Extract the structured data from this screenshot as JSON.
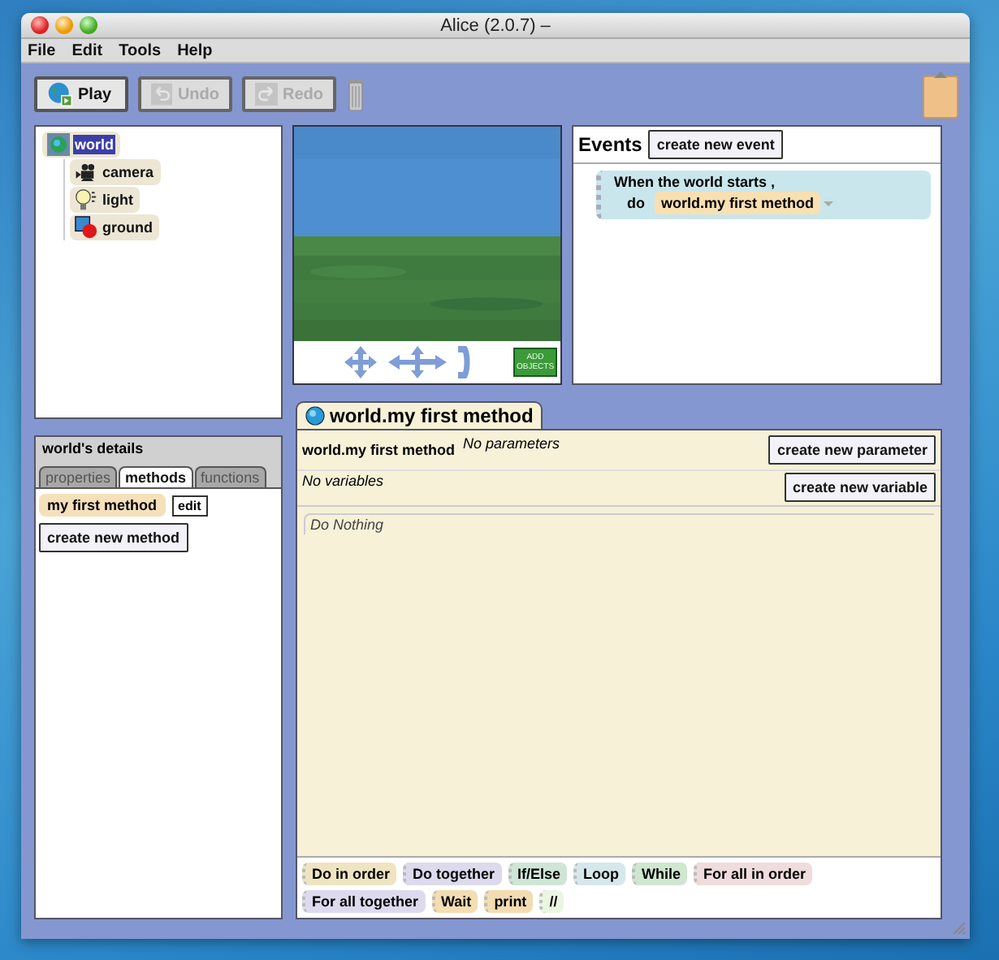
{
  "window": {
    "title": "Alice (2.0.7) –"
  },
  "menu": [
    "File",
    "Edit",
    "Tools",
    "Help"
  ],
  "toolbar": [
    {
      "label": "Play",
      "kind": "play",
      "disabled": false
    },
    {
      "label": "Undo",
      "kind": "undo",
      "disabled": true
    },
    {
      "label": "Redo",
      "kind": "redo",
      "disabled": true
    }
  ],
  "object_tree": [
    {
      "label": "world",
      "kind": "world",
      "selected": true,
      "children": [
        {
          "label": "camera",
          "kind": "camera",
          "selected": false
        },
        {
          "label": "light",
          "kind": "light",
          "selected": false
        },
        {
          "label": "ground",
          "kind": "ground",
          "selected": false
        }
      ]
    }
  ],
  "scene_view": {
    "add_objects_button": "ADD OBJECTS"
  },
  "events": {
    "title": "Events",
    "create_button": "create new event",
    "items": [
      {
        "trigger": "When the world starts ,",
        "do_label": "do",
        "method": "world.my first method"
      }
    ]
  },
  "details": {
    "title": "world's details",
    "tabs": [
      {
        "label": "properties",
        "selected": false
      },
      {
        "label": "methods",
        "selected": true
      },
      {
        "label": "functions",
        "selected": false
      }
    ],
    "methods": [
      {
        "label": "my first method",
        "edit_button": "edit"
      }
    ],
    "create_button": "create new method"
  },
  "editor": {
    "tab": "world.my first method",
    "method_name": "world.my first method",
    "parameters": "No parameters",
    "create_parameter_button": "create new parameter",
    "variables": "No variables",
    "create_variable_button": "create new variable",
    "body": "Do Nothing"
  },
  "palette": [
    {
      "label": "Do in order",
      "color": "#efe4c2"
    },
    {
      "label": "Do together",
      "color": "#dcdaec"
    },
    {
      "label": "If/Else",
      "color": "#cfe6d6"
    },
    {
      "label": "Loop",
      "color": "#d6e8ec"
    },
    {
      "label": "While",
      "color": "#cfe6cf"
    },
    {
      "label": "For all in order",
      "color": "#efdcdc"
    },
    {
      "label": "For all together",
      "color": "#dedaee"
    },
    {
      "label": "Wait",
      "color": "#f3deb2"
    },
    {
      "label": "print",
      "color": "#f4dcb2"
    },
    {
      "label": "//",
      "color": "#eaf6e2"
    }
  ]
}
